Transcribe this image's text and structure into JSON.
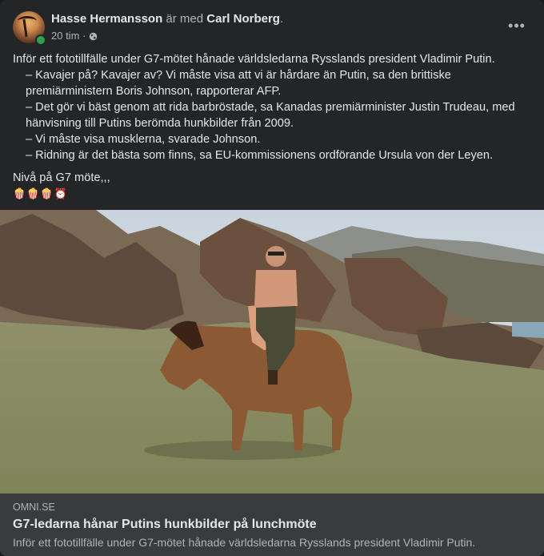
{
  "post": {
    "author": "Hasse Hermansson",
    "with_text": "är med",
    "tagged": "Carl Norberg",
    "tagged_suffix": ".",
    "time": "20 tim ·",
    "privacy_icon": "globe-icon",
    "more_icon": "more-options-icon",
    "more_label": "•••",
    "lines": [
      "Inför ett fototillfälle under G7-mötet hånade världsledarna Rysslands president Vladimir Putin.",
      "– Kavajer på? Kavajer av? Vi måste visa att vi är hårdare än Putin, sa den brittiske premiärministern Boris Johnson, rapporterar AFP.",
      "– Det gör vi bäst genom att rida barbröstade, sa Kanadas premiärminister Justin Trudeau, med hänvisning till Putins berömda hunkbilder från 2009.",
      "– Vi måste visa musklerna, svarade Johnson.",
      "– Ridning är det bästa som finns, sa EU-kommissionens ordförande Ursula von der Leyen."
    ],
    "comment": "Nivå på G7 möte,,,",
    "emojis": "🍿🍿🍿⏰"
  },
  "link": {
    "domain": "OMNI.SE",
    "title": "G7-ledarna hånar Putins hunkbilder på lunchmöte",
    "description": "Inför ett fototillfälle under G7-mötet hånade världsledarna Rysslands president Vladimir Putin."
  },
  "colors": {
    "background": "#18191a",
    "card": "#242526",
    "link_box": "#3a3b3c",
    "online": "#31a24c"
  }
}
